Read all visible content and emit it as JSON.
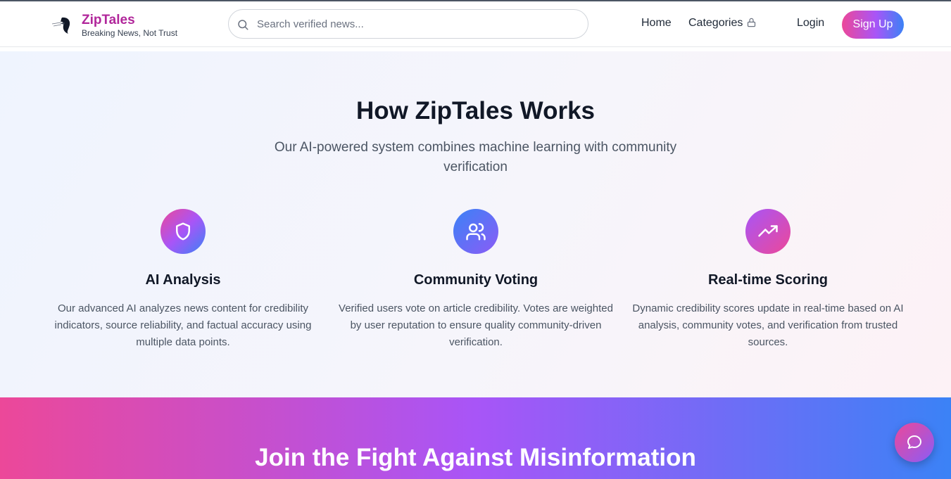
{
  "header": {
    "brand_name": "ZipTales",
    "brand_tagline": "Breaking News, Not Trust",
    "search_placeholder": "Search verified news...",
    "nav": {
      "home": "Home",
      "categories": "Categories",
      "login": "Login",
      "signup": "Sign Up"
    }
  },
  "how_it_works": {
    "title": "How ZipTales Works",
    "subtitle": "Our AI-powered system combines machine learning with community verification",
    "features": [
      {
        "icon": "shield-icon",
        "title": "AI Analysis",
        "text": "Our advanced AI analyzes news content for credibility indicators, source reliability, and factual accuracy using multiple data points."
      },
      {
        "icon": "users-icon",
        "title": "Community Voting",
        "text": "Verified users vote on article credibility. Votes are weighted by user reputation to ensure quality community-driven verification."
      },
      {
        "icon": "trending-up-icon",
        "title": "Real-time Scoring",
        "text": "Dynamic credibility scores update in real-time based on AI analysis, community votes, and verification from trusted sources."
      }
    ]
  },
  "cta": {
    "title": "Join the Fight Against Misinformation"
  },
  "colors": {
    "brand": "#b1279b",
    "gradient_start": "#ec4899",
    "gradient_mid": "#a855f7",
    "gradient_end": "#3b82f6"
  }
}
